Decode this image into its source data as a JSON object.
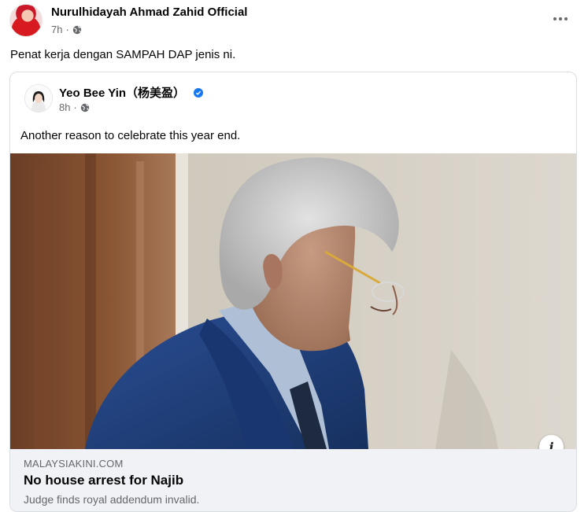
{
  "post": {
    "author": "Nurulhidayah Ahmad Zahid Official",
    "time": "7h",
    "privacy_icon": "globe-icon",
    "text": "Penat kerja dengan SAMPAH DAP jenis ni."
  },
  "shared": {
    "author": "Yeo Bee Yin（杨美盈）",
    "verified_icon": "verified-badge-icon",
    "time": "8h",
    "text": "Another reason to celebrate this year end.",
    "link": {
      "domain": "MALAYSIAKINI.COM",
      "title": "No house arrest for Najib",
      "description": "Judge finds royal addendum invalid."
    }
  },
  "colors": {
    "link_preview_bg": "#f0f2f5",
    "verified": "#1877f2",
    "meta_text": "#65676b"
  }
}
